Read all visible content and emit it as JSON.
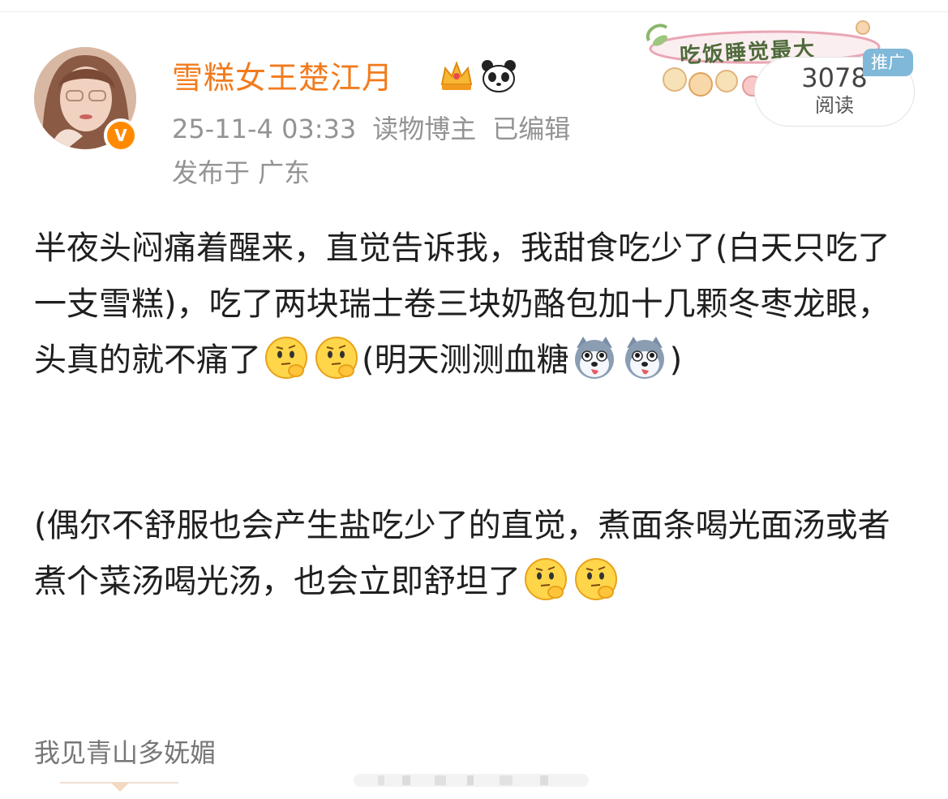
{
  "post": {
    "username": "雪糕女王楚江月",
    "timestamp": "25-11-4 03:33",
    "role": "读物博主",
    "edited": "已编辑",
    "location": "发布于 广东",
    "read_count": "3078",
    "read_label": "阅读",
    "promo_badge": "推广",
    "deco_banner_text": "吃饭睡觉最大",
    "verified_badge": "V",
    "body": {
      "para1_part1": "半夜头闷痛着醒来，直觉告诉我，我甜食吃少了(白天只吃了一支雪糕)，吃了两块瑞士卷三块奶酪包加十几颗冬枣龙眼，头真的就不痛了",
      "para1_part2": "(明天测测血糖",
      "para1_part3": ")",
      "para2": "(偶尔不舒服也会产生盐吃少了的直觉，煮面条喝光面汤或者煮个菜汤喝光汤，也会立即舒坦了"
    }
  },
  "comment": {
    "preview": "我见青山多妩媚"
  },
  "colors": {
    "username": "#f27b1d",
    "meta": "#939393",
    "verified": "#ff8a00",
    "promo": "#7fb8d8"
  },
  "icons": [
    "crown-icon",
    "panda-icon",
    "thinking-face-emoji",
    "husky-face-emoji",
    "verified-badge-icon"
  ]
}
